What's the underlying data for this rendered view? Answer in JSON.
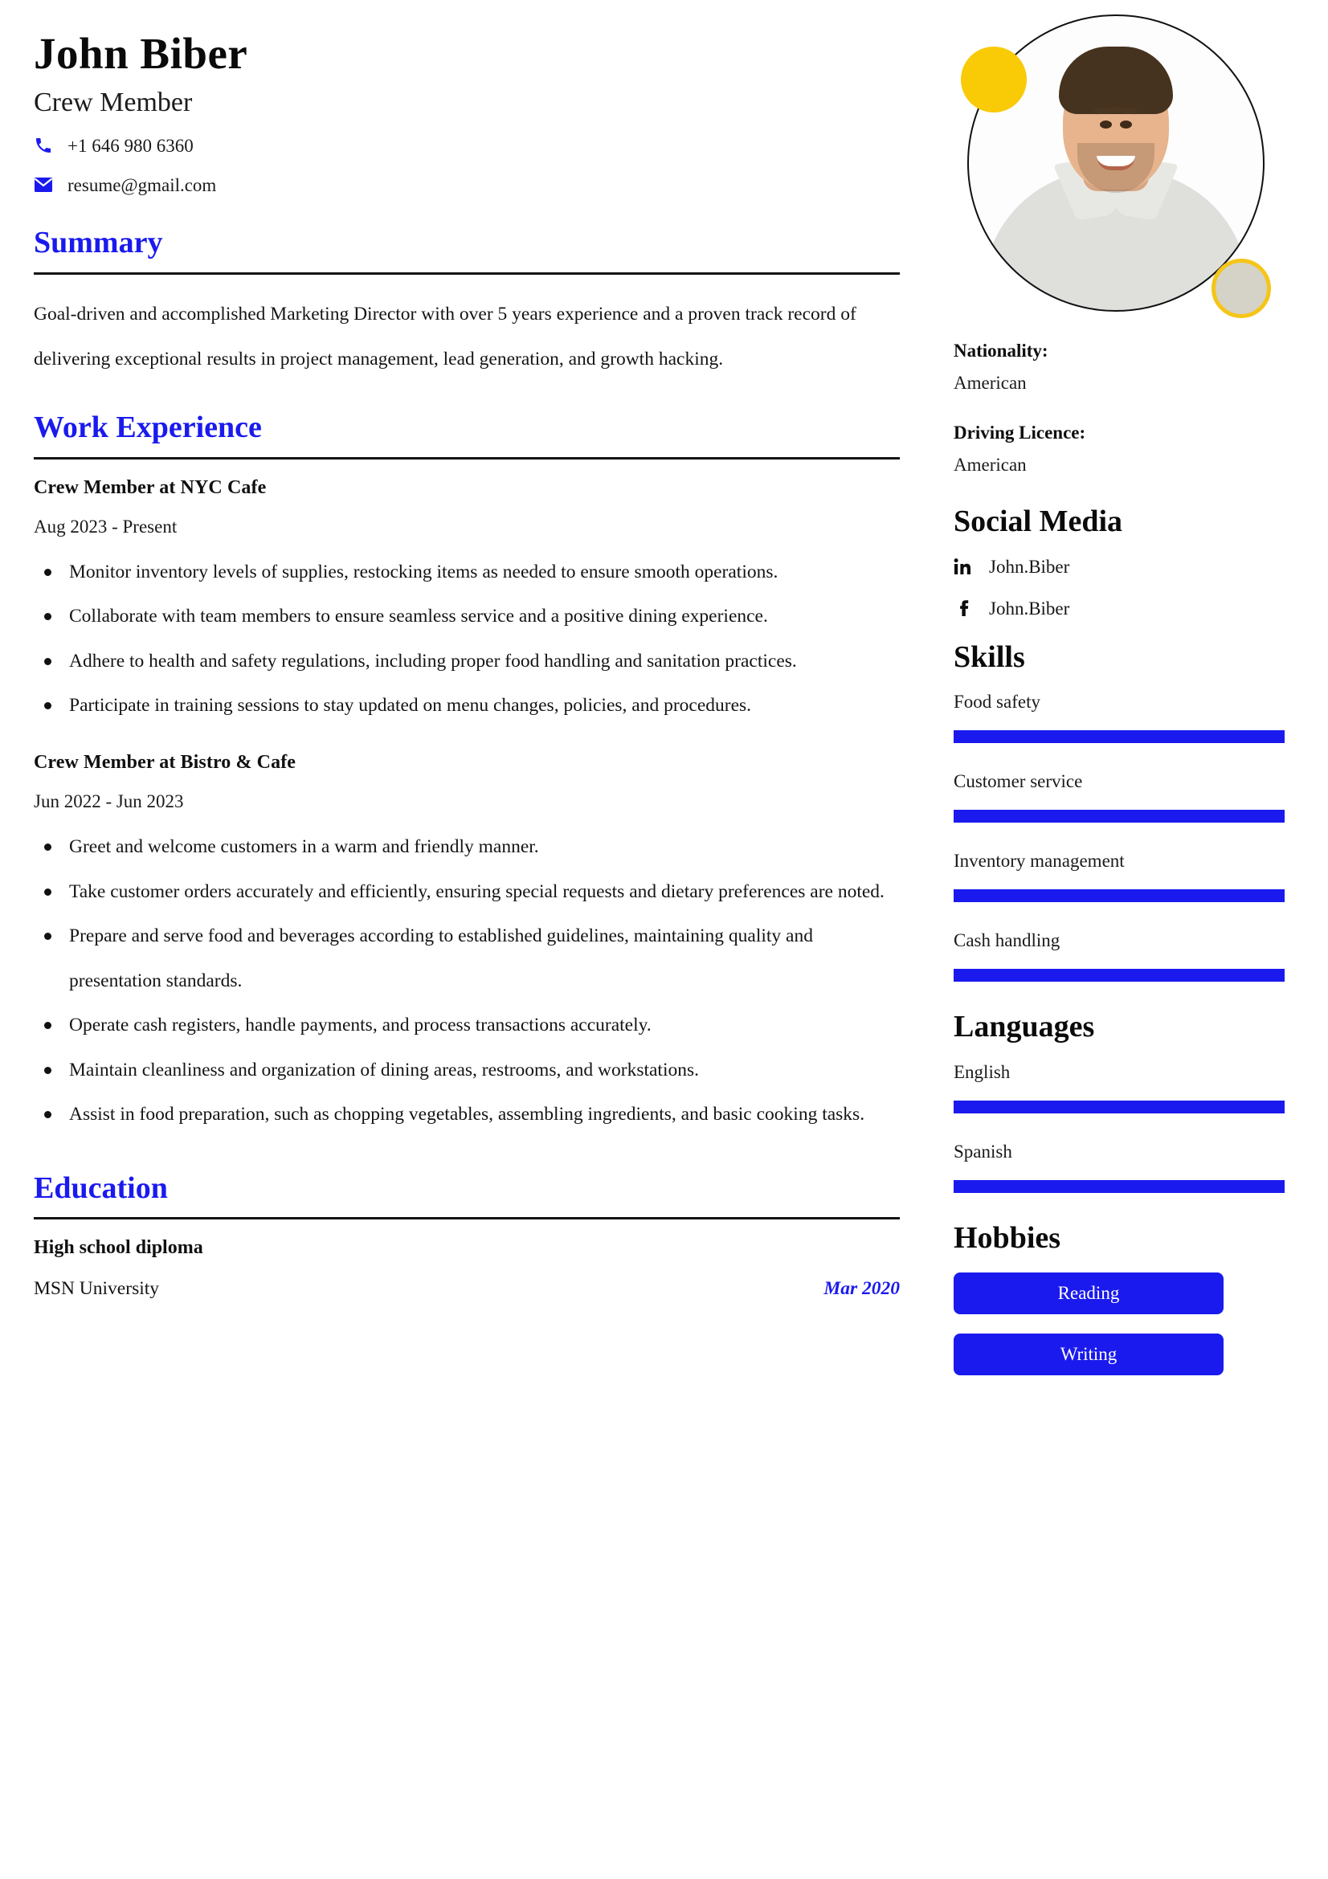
{
  "header": {
    "name": "John Biber",
    "title": "Crew Member",
    "phone": "+1 646 980 6360",
    "email": "resume@gmail.com",
    "phone_icon": "phone-icon",
    "email_icon": "envelope-icon"
  },
  "colors": {
    "accent_blue": "#1a1aee",
    "rule_black": "#141414",
    "yellow_dot": "#f9ca06",
    "grey_dot": "#d5d2c7",
    "chip_text": "#ffffff"
  },
  "summary": {
    "heading": "Summary",
    "text": "Goal-driven and accomplished Marketing Director with over 5 years experience and a proven track record of delivering exceptional results in project management, lead generation, and growth hacking."
  },
  "work_experience": {
    "heading": "Work Experience",
    "jobs": [
      {
        "title": "Crew Member at NYC Cafe",
        "dates": "Aug 2023 - Present",
        "bullets": [
          "Monitor inventory levels of supplies, restocking items as needed to ensure smooth operations.",
          "Collaborate with team members to ensure seamless service and a positive dining experience.",
          "Adhere to health and safety regulations, including proper food handling and sanitation practices.",
          "Participate in training sessions to stay updated on menu changes, policies, and procedures."
        ]
      },
      {
        "title": "Crew Member at Bistro & Cafe",
        "dates": "Jun 2022 - Jun 2023",
        "bullets": [
          "Greet and welcome customers in a warm and friendly manner.",
          "Take customer orders accurately and efficiently, ensuring special requests and dietary preferences are noted.",
          "Prepare and serve food and beverages according to established guidelines, maintaining quality and presentation standards.",
          "Operate cash registers, handle payments, and process transactions accurately.",
          "Maintain cleanliness and organization of dining areas, restrooms, and workstations.",
          "Assist in food preparation, such as chopping vegetables, assembling ingredients, and basic cooking tasks."
        ]
      }
    ]
  },
  "education": {
    "heading": "Education",
    "degree": "High school diploma",
    "school": "MSN University",
    "date": "Mar 2020"
  },
  "sidebar": {
    "photo_alt": "profile-photo",
    "nationality_label": "Nationality:",
    "nationality_value": "American",
    "driving_label": "Driving Licence:",
    "driving_value": "American",
    "social": {
      "heading": "Social Media",
      "items": [
        {
          "icon": "linkedin-icon",
          "label": "John.Biber"
        },
        {
          "icon": "facebook-icon",
          "label": "John.Biber"
        }
      ]
    },
    "skills": {
      "heading": "Skills",
      "items": [
        {
          "label": "Food safety",
          "level": 100
        },
        {
          "label": "Customer service",
          "level": 100
        },
        {
          "label": "Inventory management",
          "level": 100
        },
        {
          "label": "Cash handling",
          "level": 100
        }
      ]
    },
    "languages": {
      "heading": "Languages",
      "items": [
        {
          "label": "English",
          "level": 100
        },
        {
          "label": "Spanish",
          "level": 100
        }
      ]
    },
    "hobbies": {
      "heading": "Hobbies",
      "items": [
        {
          "label": "Reading"
        },
        {
          "label": "Writing"
        }
      ]
    }
  }
}
